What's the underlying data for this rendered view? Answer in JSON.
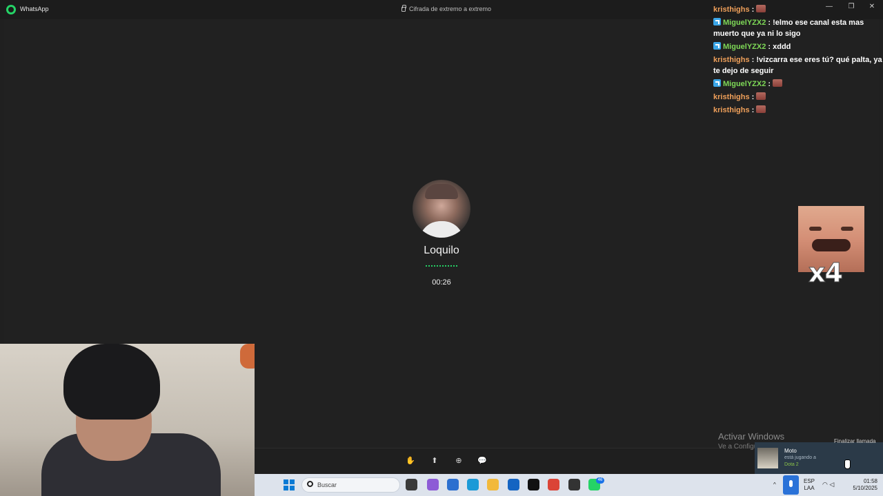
{
  "window": {
    "app_title": "WhatsApp",
    "encryption_text": "Cifrada de extremo a extremo",
    "minimize": "—",
    "maximize": "❐",
    "close": "✕"
  },
  "call": {
    "caller_name": "Loquilo",
    "duration": "00:26",
    "end_call_tooltip": "Finalizar llamada",
    "controls": [
      {
        "name": "raise-hand",
        "glyph": "✋"
      },
      {
        "name": "share-screen",
        "glyph": "⬆"
      },
      {
        "name": "add-participant",
        "glyph": "⊕"
      },
      {
        "name": "chat",
        "glyph": "💬"
      }
    ]
  },
  "chat": {
    "messages": [
      {
        "user": "kristhighs",
        "badge": false,
        "text": "",
        "emotes": 1,
        "color": "#f0a05a"
      },
      {
        "user": "MiguelYZX2",
        "badge": true,
        "text": "!elmo ese canal esta mas muerto que ya ni lo sigo",
        "emotes": 0,
        "color": "#7ed957"
      },
      {
        "user": "MiguelYZX2",
        "badge": true,
        "text": "xddd",
        "emotes": 0,
        "color": "#7ed957"
      },
      {
        "user": "kristhighs",
        "badge": false,
        "text": "!vizcarra ese eres tú? qué palta, ya te dejo de seguir",
        "emotes": 0,
        "color": "#f0a05a"
      },
      {
        "user": "MiguelYZX2",
        "badge": true,
        "text": "",
        "emotes": 1,
        "color": "#7ed957"
      },
      {
        "user": "kristhighs",
        "badge": false,
        "text": "",
        "emotes": 1,
        "color": "#f0a05a"
      },
      {
        "user": "kristhighs",
        "badge": false,
        "text": "",
        "emotes": 1,
        "color": "#f0a05a"
      }
    ],
    "big_emote_multiplier": "x4"
  },
  "watermark": {
    "line1": "Activar Windows",
    "line2": "Ve a Configuración para activar Windows."
  },
  "notification": {
    "name": "Moto",
    "subtitle": "está jugando a",
    "game": "Dota 2"
  },
  "taskbar": {
    "search_placeholder": "Buscar",
    "whatsapp_badge": "46",
    "language_line1": "ESP",
    "language_line2": "LAA",
    "time": "01:58",
    "date": "5/10/2025",
    "tray_chevron": "^",
    "apps": [
      {
        "name": "file-explorer",
        "color": "#3a3a3a"
      },
      {
        "name": "copilot",
        "color": "#8d5bd6"
      },
      {
        "name": "store",
        "color": "#2b6fcf"
      },
      {
        "name": "edge",
        "color": "#1b9ad7"
      },
      {
        "name": "folder",
        "color": "#f2b93b"
      },
      {
        "name": "outlook",
        "color": "#1464c2"
      },
      {
        "name": "tiktok",
        "color": "#111111"
      },
      {
        "name": "chrome",
        "color": "#db4437"
      },
      {
        "name": "app-dark",
        "color": "#333333"
      },
      {
        "name": "whatsapp",
        "color": "#25d366"
      }
    ]
  }
}
